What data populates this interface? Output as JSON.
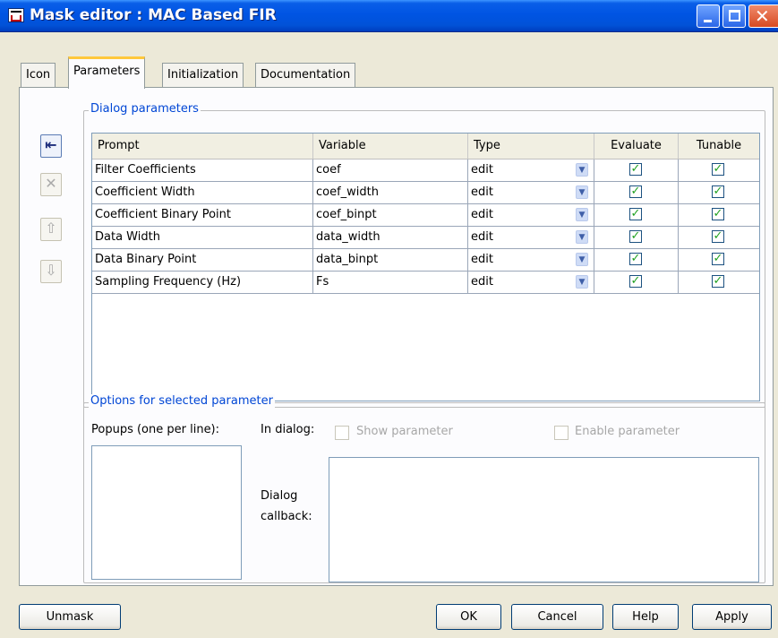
{
  "window": {
    "title": "Mask editor : MAC Based FIR",
    "buttons": {
      "minimize": "minimize",
      "maximize": "maximize",
      "close": "close"
    }
  },
  "tabs": [
    {
      "label": "Icon",
      "active": false
    },
    {
      "label": "Parameters",
      "active": true
    },
    {
      "label": "Initialization",
      "active": false
    },
    {
      "label": "Documentation",
      "active": false
    }
  ],
  "dialog_parameters": {
    "legend": "Dialog parameters",
    "side_buttons": [
      {
        "icon": "add-parameter-icon",
        "enabled": true
      },
      {
        "icon": "delete-icon",
        "enabled": false
      },
      {
        "icon": "move-up-icon",
        "enabled": false
      },
      {
        "icon": "move-down-icon",
        "enabled": false
      }
    ],
    "columns": [
      "Prompt",
      "Variable",
      "Type",
      "Evaluate",
      "Tunable"
    ],
    "rows": [
      {
        "prompt": "Filter Coefficients",
        "variable": "coef",
        "type": "edit",
        "evaluate": true,
        "tunable": true
      },
      {
        "prompt": "Coefficient Width",
        "variable": "coef_width",
        "type": "edit",
        "evaluate": true,
        "tunable": true
      },
      {
        "prompt": "Coefficient Binary Point",
        "variable": "coef_binpt",
        "type": "edit",
        "evaluate": true,
        "tunable": true
      },
      {
        "prompt": "Data Width",
        "variable": "data_width",
        "type": "edit",
        "evaluate": true,
        "tunable": true
      },
      {
        "prompt": "Data Binary Point",
        "variable": "data_binpt",
        "type": "edit",
        "evaluate": true,
        "tunable": true
      },
      {
        "prompt": "Sampling Frequency (Hz)",
        "variable": "Fs",
        "type": "edit",
        "evaluate": true,
        "tunable": true
      }
    ]
  },
  "options": {
    "legend": "Options for selected parameter",
    "popups_label": "Popups (one per line):",
    "in_dialog_label": "In dialog:",
    "show_parameter_label": "Show parameter",
    "enable_parameter_label": "Enable parameter",
    "dialog_callback_label_line1": "Dialog",
    "dialog_callback_label_line2": "callback:",
    "popups_value": "",
    "callback_value": ""
  },
  "footer": {
    "unmask": "Unmask",
    "ok": "OK",
    "cancel": "Cancel",
    "help": "Help",
    "apply": "Apply"
  },
  "colors": {
    "titlebar": "#0054e3",
    "legend_text": "#0046d5",
    "check": "#21a121",
    "active_tab_accent": "#ffc83c"
  }
}
